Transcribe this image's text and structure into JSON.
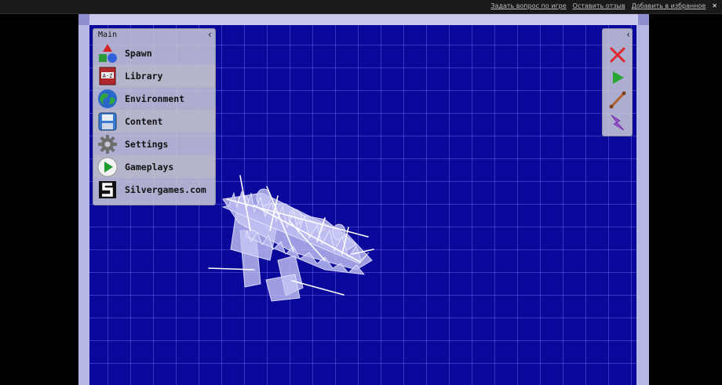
{
  "topbar": {
    "links": [
      "Задать вопрос по игре",
      "Оставить отзыв",
      "Добавить в избранное"
    ],
    "close_glyph": "✕"
  },
  "menu": {
    "title": "Main",
    "collapse_glyph": "‹",
    "items": [
      {
        "label": "Spawn",
        "icon": "spawn-shapes-icon"
      },
      {
        "label": "Library",
        "icon": "library-book-icon"
      },
      {
        "label": "Environment",
        "icon": "globe-icon"
      },
      {
        "label": "Content",
        "icon": "floppy-disk-icon"
      },
      {
        "label": "Settings",
        "icon": "gear-icon"
      },
      {
        "label": "Gameplays",
        "icon": "play-circle-icon"
      },
      {
        "label": "Silvergames.com",
        "icon": "silvergames-logo-icon"
      }
    ]
  },
  "tools": {
    "collapse_glyph": "‹",
    "items": [
      {
        "name": "delete-tool",
        "icon": "red-x-icon",
        "color": "#e0262b"
      },
      {
        "name": "play-tool",
        "icon": "green-play-icon",
        "color": "#27a633"
      },
      {
        "name": "connect-tool",
        "icon": "rope-stick-icon",
        "color": "#b0622a"
      },
      {
        "name": "power-tool",
        "icon": "lightning-icon",
        "color": "#9a4fd6"
      }
    ]
  },
  "colors": {
    "playfield": "#0a089a",
    "grid": "#828cff",
    "frame": "#b7b7e6",
    "panel": "#c8c8d7"
  }
}
